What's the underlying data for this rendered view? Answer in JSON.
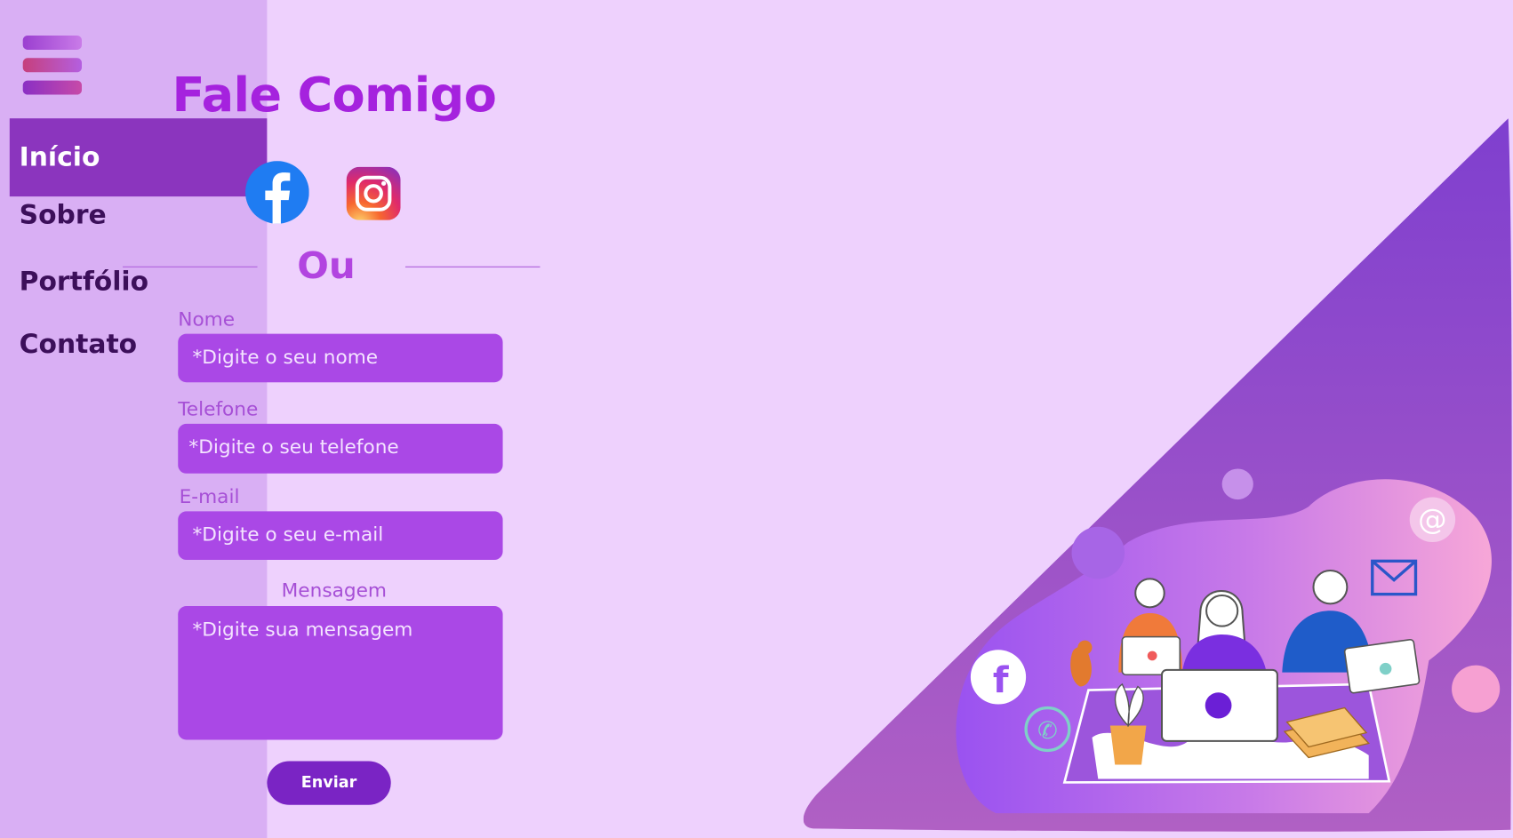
{
  "sidebar": {
    "items": [
      {
        "label": "Início",
        "active": true
      },
      {
        "label": "Sobre",
        "active": false
      },
      {
        "label": "Portfólio",
        "active": false
      },
      {
        "label": "Contato",
        "active": false
      }
    ]
  },
  "contact": {
    "title": "Fale Comigo",
    "or_label": "Ou",
    "social": [
      "facebook-icon",
      "instagram-icon"
    ]
  },
  "form": {
    "name_label": "Nome",
    "name_placeholder": "*Digite o seu nome",
    "phone_label": "Telefone",
    "phone_placeholder": "*Digite o seu telefone",
    "email_label": "E-mail",
    "email_placeholder": "*Digite o seu e-mail",
    "message_label": "Mensagem",
    "message_placeholder": "*Digite sua mensagem",
    "submit_label": "Enviar"
  },
  "colors": {
    "page_bg": "#eed1fd",
    "sidebar_bg": "#d9aff4",
    "accent": "#a522de",
    "active_nav": "#8b35be",
    "input_bg": "#aa48e6",
    "button_bg": "#7a24c4"
  }
}
